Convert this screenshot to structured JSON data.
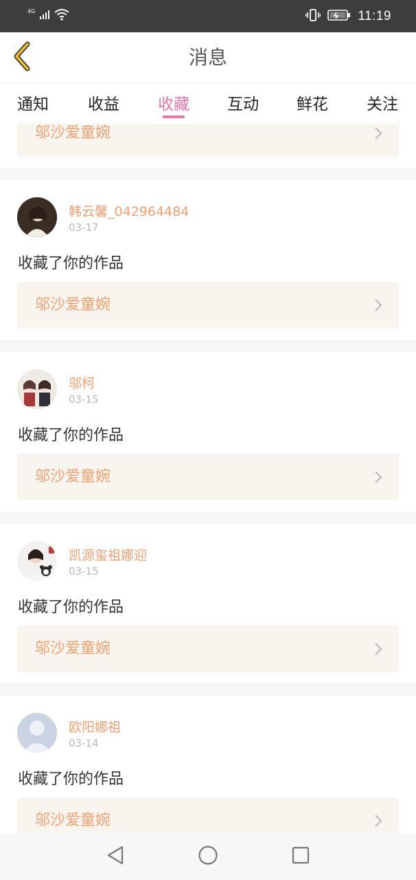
{
  "status_bar": {
    "network": "4G",
    "time": "11:19",
    "icons": [
      "signal-icon",
      "wifi-icon",
      "vibrate-icon",
      "battery-charging-icon"
    ]
  },
  "header": {
    "title": "消息",
    "back_icon": "chevron-left-icon",
    "accent_color": "#f2c12e"
  },
  "tabs": {
    "items": [
      {
        "label": "通知"
      },
      {
        "label": "收益"
      },
      {
        "label": "收藏",
        "active": true
      },
      {
        "label": "互动"
      },
      {
        "label": "鲜花"
      },
      {
        "label": "关注"
      }
    ],
    "active_color": "#e874a4"
  },
  "feed": {
    "partial_top_work_title": "邬沙爱童婉",
    "items": [
      {
        "username": "韩云馨_042964484",
        "date": "03-17",
        "action": "收藏了你的作品",
        "work_title": "邬沙爱童婉",
        "avatar": "photo-avatar"
      },
      {
        "username": "邬柯",
        "date": "03-15",
        "action": "收藏了你的作品",
        "work_title": "邬沙爱童婉",
        "avatar": "cartoon-avatar"
      },
      {
        "username": "凯源玺祖娜迎",
        "date": "03-15",
        "action": "收藏了你的作品",
        "work_title": "邬沙爱童婉",
        "avatar": "photo-avatar"
      },
      {
        "username": "欧阳娜祖",
        "date": "03-14",
        "action": "收藏了你的作品",
        "work_title": "邬沙爱童婉",
        "avatar": "default-avatar"
      }
    ],
    "name_color": "#f0a070"
  },
  "nav": {
    "back": "nav-back-icon",
    "home": "nav-home-icon",
    "recents": "nav-recents-icon"
  }
}
